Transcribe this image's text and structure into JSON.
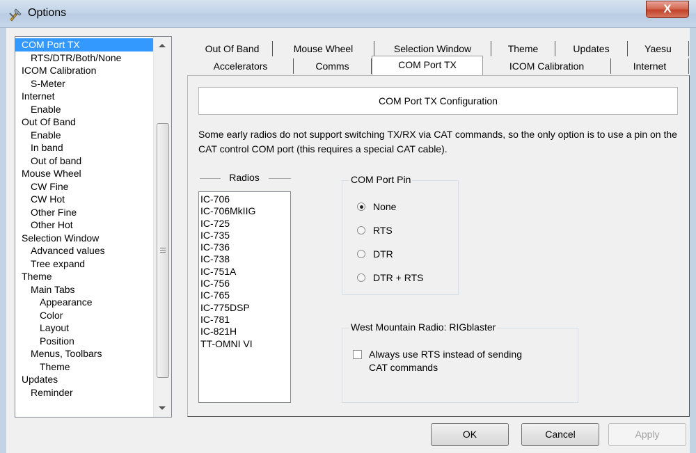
{
  "window": {
    "title": "Options",
    "close_label": "X"
  },
  "tree": {
    "items": [
      {
        "label": "COM Port TX",
        "level": 0,
        "selected": true
      },
      {
        "label": "RTS/DTR/Both/None",
        "level": 1
      },
      {
        "label": "ICOM Calibration",
        "level": 0
      },
      {
        "label": "S-Meter",
        "level": 1
      },
      {
        "label": "Internet",
        "level": 0
      },
      {
        "label": "Enable",
        "level": 1
      },
      {
        "label": "Out Of Band",
        "level": 0
      },
      {
        "label": "Enable",
        "level": 1
      },
      {
        "label": "In band",
        "level": 1
      },
      {
        "label": "Out of band",
        "level": 1
      },
      {
        "label": "Mouse Wheel",
        "level": 0
      },
      {
        "label": "CW Fine",
        "level": 1
      },
      {
        "label": "CW Hot",
        "level": 1
      },
      {
        "label": "Other Fine",
        "level": 1
      },
      {
        "label": "Other Hot",
        "level": 1
      },
      {
        "label": "Selection Window",
        "level": 0
      },
      {
        "label": "Advanced values",
        "level": 1
      },
      {
        "label": "Tree expand",
        "level": 1
      },
      {
        "label": "Theme",
        "level": 0
      },
      {
        "label": "Main Tabs",
        "level": 1
      },
      {
        "label": "Appearance",
        "level": 2
      },
      {
        "label": "Color",
        "level": 2
      },
      {
        "label": "Layout",
        "level": 2
      },
      {
        "label": "Position",
        "level": 2
      },
      {
        "label": "Menus, Toolbars",
        "level": 1
      },
      {
        "label": "Theme",
        "level": 2
      },
      {
        "label": "Updates",
        "level": 0
      },
      {
        "label": "Reminder",
        "level": 1
      }
    ]
  },
  "tabs": {
    "row1": [
      "Out Of Band",
      "Mouse Wheel",
      "Selection Window",
      "Theme",
      "Updates",
      "Yaesu"
    ],
    "row2": [
      "Accelerators",
      "Comms",
      "COM Port TX",
      "ICOM Calibration",
      "Internet"
    ],
    "active": "COM Port TX"
  },
  "panel": {
    "header": "COM Port TX Configuration",
    "description": "Some early radios do not support switching TX/RX via CAT commands, so the only option is to use a pin on the CAT control COM port (this requires a special CAT cable).",
    "radios_label": "Radios",
    "radios": [
      "IC-706",
      "IC-706MkIIG",
      "IC-725",
      "IC-735",
      "IC-736",
      "IC-738",
      "IC-751A",
      "IC-756",
      "IC-765",
      "IC-775DSP",
      "IC-781",
      "IC-821H",
      "TT-OMNI VI"
    ],
    "com_pin_title": "COM Port Pin",
    "com_pin_options": [
      "None",
      "RTS",
      "DTR",
      "DTR + RTS"
    ],
    "com_pin_selected": "None",
    "rigblaster_title": "West Mountain Radio: RIGblaster",
    "rigblaster_checkbox_line1": "Always use RTS instead of sending",
    "rigblaster_checkbox_line2": "CAT commands",
    "rigblaster_checked": false
  },
  "buttons": {
    "ok": "OK",
    "cancel": "Cancel",
    "apply": "Apply"
  }
}
